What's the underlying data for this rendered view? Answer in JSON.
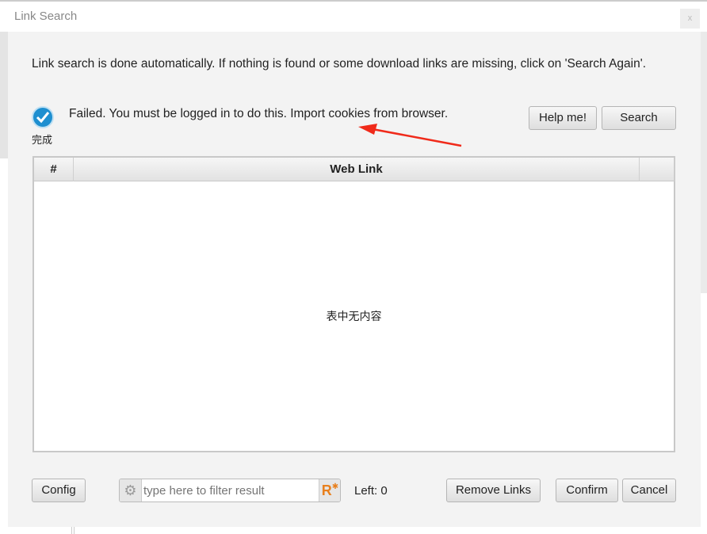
{
  "window": {
    "title": "Link Search",
    "close_label": "x"
  },
  "intro": "Link search is done automatically. If nothing is found or some download links are missing, click on 'Search Again'.",
  "status": {
    "message": "Failed. You must be logged in to do this. Import cookies from browser.",
    "icon_label": "完成",
    "icon": "check-circle-icon",
    "accent": "#1e8fd0"
  },
  "buttons": {
    "help": "Help me!",
    "search": "Search",
    "config": "Config",
    "remove": "Remove Links",
    "confirm": "Confirm",
    "cancel": "Cancel"
  },
  "table": {
    "columns": [
      "#",
      "Web Link",
      ""
    ],
    "empty_text": "表中无内容"
  },
  "filter": {
    "placeholder": "type here to filter result",
    "value": ""
  },
  "left_count": "Left: 0",
  "annotation_color": "#f02a1a"
}
